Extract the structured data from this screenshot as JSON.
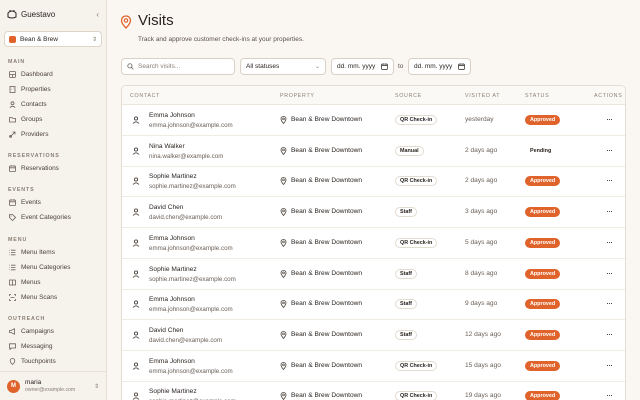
{
  "app": {
    "name": "Guestavo",
    "collapse_icon": "chevron-left-icon"
  },
  "property_selector": {
    "value": "Bean & Brew"
  },
  "sidebar": {
    "sections": [
      {
        "title": "MAIN",
        "items": [
          {
            "label": "Dashboard",
            "icon": "dashboard-icon"
          },
          {
            "label": "Properties",
            "icon": "building-icon"
          },
          {
            "label": "Contacts",
            "icon": "contacts-icon"
          },
          {
            "label": "Groups",
            "icon": "folder-icon"
          },
          {
            "label": "Providers",
            "icon": "link-icon"
          }
        ]
      },
      {
        "title": "RESERVATIONS",
        "items": [
          {
            "label": "Reservations",
            "icon": "calendar-icon"
          }
        ]
      },
      {
        "title": "EVENTS",
        "items": [
          {
            "label": "Events",
            "icon": "calendar-icon"
          },
          {
            "label": "Event Categories",
            "icon": "tag-icon"
          }
        ]
      },
      {
        "title": "MENU",
        "items": [
          {
            "label": "Menu Items",
            "icon": "list-icon"
          },
          {
            "label": "Menu Categories",
            "icon": "list-icon"
          },
          {
            "label": "Menus",
            "icon": "book-icon"
          },
          {
            "label": "Menu Scans",
            "icon": "scan-icon"
          }
        ]
      },
      {
        "title": "OUTREACH",
        "items": [
          {
            "label": "Campaigns",
            "icon": "megaphone-icon"
          },
          {
            "label": "Messaging",
            "icon": "message-icon"
          },
          {
            "label": "Touchpoints",
            "icon": "pin-icon"
          }
        ]
      }
    ]
  },
  "user": {
    "initial": "M",
    "name": "maria",
    "email": "owner@example.com"
  },
  "page": {
    "title": "Visits",
    "subtitle": "Track and approve customer check-ins at your properties."
  },
  "filters": {
    "search_placeholder": "Search visits...",
    "status_value": "All statuses",
    "date_from": "dd. mm. yyyy",
    "date_to": "dd. mm. yyyy",
    "to_label": "to"
  },
  "table": {
    "columns": [
      "CONTACT",
      "PROPERTY",
      "SOURCE",
      "VISITED AT",
      "STATUS",
      "ACTIONS"
    ],
    "rows": [
      {
        "name": "Emma Johnson",
        "email": "emma.johnson@example.com",
        "property": "Bean & Brew Downtown",
        "source": "QR Check-in",
        "visited": "yesterday",
        "status": "Approved"
      },
      {
        "name": "Nina Walker",
        "email": "nina.walker@example.com",
        "property": "Bean & Brew Downtown",
        "source": "Manual",
        "visited": "2 days ago",
        "status": "Pending"
      },
      {
        "name": "Sophie Martinez",
        "email": "sophie.martinez@example.com",
        "property": "Bean & Brew Downtown",
        "source": "QR Check-in",
        "visited": "2 days ago",
        "status": "Approved"
      },
      {
        "name": "David Chen",
        "email": "david.chen@example.com",
        "property": "Bean & Brew Downtown",
        "source": "Staff",
        "visited": "3 days ago",
        "status": "Approved"
      },
      {
        "name": "Emma Johnson",
        "email": "emma.johnson@example.com",
        "property": "Bean & Brew Downtown",
        "source": "QR Check-in",
        "visited": "5 days ago",
        "status": "Approved"
      },
      {
        "name": "Sophie Martinez",
        "email": "sophie.martinez@example.com",
        "property": "Bean & Brew Downtown",
        "source": "Staff",
        "visited": "8 days ago",
        "status": "Approved"
      },
      {
        "name": "Emma Johnson",
        "email": "emma.johnson@example.com",
        "property": "Bean & Brew Downtown",
        "source": "Staff",
        "visited": "9 days ago",
        "status": "Approved"
      },
      {
        "name": "David Chen",
        "email": "david.chen@example.com",
        "property": "Bean & Brew Downtown",
        "source": "Staff",
        "visited": "12 days ago",
        "status": "Approved"
      },
      {
        "name": "Emma Johnson",
        "email": "emma.johnson@example.com",
        "property": "Bean & Brew Downtown",
        "source": "QR Check-in",
        "visited": "15 days ago",
        "status": "Approved"
      },
      {
        "name": "Sophie Martinez",
        "email": "sophie.martinez@example.com",
        "property": "Bean & Brew Downtown",
        "source": "QR Check-in",
        "visited": "19 days ago",
        "status": "Approved"
      }
    ],
    "row_action": "···"
  },
  "colors": {
    "accent": "#e0632b",
    "background": "#faf7f2",
    "sidebar": "#f6f2ec"
  }
}
